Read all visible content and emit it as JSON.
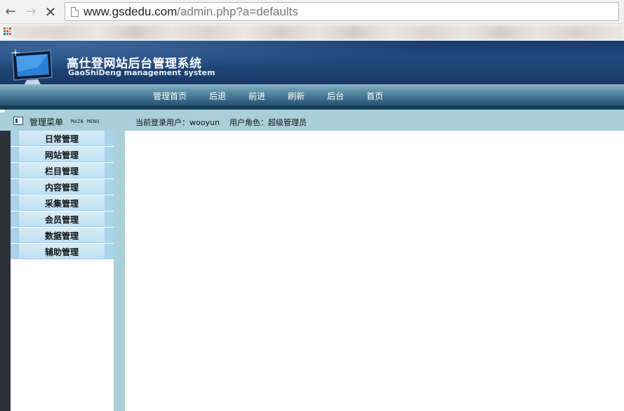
{
  "browser": {
    "url_host": "www.gsdedu.com",
    "url_path": "/admin.php?a=defaults",
    "back_icon": "←",
    "forward_icon": "→",
    "stop_icon": "✕"
  },
  "header": {
    "title": "高仕登网站后台管理系统",
    "subtitle": "GaoShiDeng management system"
  },
  "top_nav": {
    "items": [
      {
        "label": "管理首页"
      },
      {
        "label": "后退"
      },
      {
        "label": "前进"
      },
      {
        "label": "刷新"
      },
      {
        "label": "后台"
      },
      {
        "label": "首页"
      }
    ]
  },
  "menu_header": {
    "title": "管理菜单",
    "subtitle": "MAIN MENU"
  },
  "user_info": {
    "user_label": "当前登录用户：",
    "user_name": "wooyun",
    "role_label": "用户角色：",
    "role_name": "超级管理员"
  },
  "sidebar": {
    "items": [
      {
        "label": "日常管理"
      },
      {
        "label": "网站管理"
      },
      {
        "label": "栏目管理"
      },
      {
        "label": "内容管理"
      },
      {
        "label": "采集管理"
      },
      {
        "label": "会员管理"
      },
      {
        "label": "数据管理"
      },
      {
        "label": "辅助管理"
      }
    ]
  },
  "colors": {
    "header_bg": "#1b3e6c",
    "nav_bg": "#2f5f7e",
    "info_bar_bg": "#a9cfd8",
    "menu_item_bg": "#bfe0f3",
    "sidebar_dark": "#2c3138"
  }
}
